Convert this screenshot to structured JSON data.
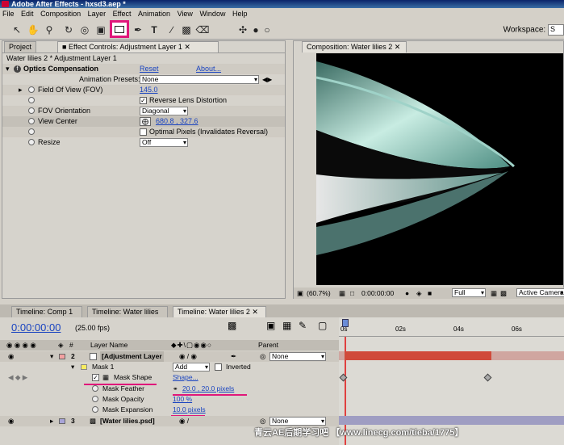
{
  "app": {
    "title": "Adobe After Effects - hxsd3.aep *"
  },
  "menu": [
    "File",
    "Edit",
    "Composition",
    "Layer",
    "Effect",
    "Animation",
    "View",
    "Window",
    "Help"
  ],
  "workspace": {
    "label": "Workspace:",
    "value": "S"
  },
  "left_panel": {
    "tab_project": "Project",
    "tab_effect_controls": "Effect Controls: Adjustment Layer 1",
    "breadcrumb": "Water lilies 2 * Adjustment Layer 1",
    "effect_name": "Optics Compensation",
    "reset": "Reset",
    "about": "About...",
    "presets_label": "Animation Presets:",
    "presets_value": "None",
    "fov_label": "Field Of View (FOV)",
    "fov_value": "145.0",
    "reverse_label": "Reverse Lens Distortion",
    "fov_orient_label": "FOV Orientation",
    "fov_orient_value": "Diagonal",
    "view_center_label": "View Center",
    "view_center_value": "680.8 , 327.6",
    "optimal_label": "Optimal Pixels (Invalidates Reversal)",
    "resize_label": "Resize",
    "resize_value": "Off"
  },
  "comp_panel": {
    "tab": "Composition: Water lilies 2",
    "zoom": "(60.7%)",
    "timecode": "0:00:00:00",
    "quality": "Full",
    "camera": "Active Camera"
  },
  "timeline": {
    "tabs": [
      "Timeline: Comp 1",
      "Timeline: Water lilies",
      "Timeline: Water lilies 2"
    ],
    "time": "0:00:00:00",
    "fps": "(25.00 fps)",
    "col_layer_name": "Layer Name",
    "col_parent": "Parent",
    "ruler": [
      "0s",
      "02s",
      "04s",
      "06s"
    ],
    "layers": [
      {
        "num": "2",
        "name": "[Adjustment Layer",
        "parent": "None"
      },
      {
        "num": "3",
        "name": "[Water lilies.psd]",
        "parent": "None"
      }
    ],
    "mask": {
      "name": "Mask 1",
      "mode": "Add",
      "inverted": "Inverted"
    },
    "mask_shape": {
      "label": "Mask Shape",
      "value": "Shape..."
    },
    "mask_feather": {
      "label": "Mask Feather",
      "value": "20.0 , 20.0 pixels"
    },
    "mask_opacity": {
      "label": "Mask Opacity",
      "value": "100 %"
    },
    "mask_expansion": {
      "label": "Mask Expansion",
      "value": "10.0 pixels"
    }
  },
  "watermark": "青云AE后期学习吧 【www.linecg.com/tieba/1775】",
  "colors": {
    "highlight": "#e0177a",
    "link": "#1a44c0",
    "layer_bar": "#d04a3a"
  }
}
